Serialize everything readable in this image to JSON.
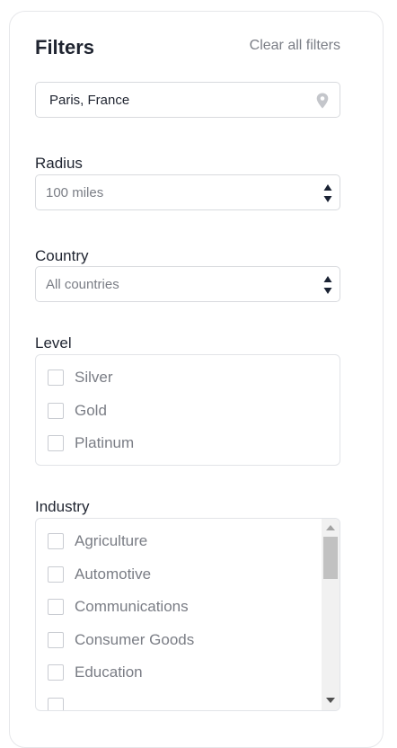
{
  "filters": {
    "title": "Filters",
    "clear_all": "Clear all filters"
  },
  "location": {
    "value": "Paris, France",
    "icon": "map-pin-icon"
  },
  "radius": {
    "label": "Radius",
    "selected": "100 miles"
  },
  "country": {
    "label": "Country",
    "selected": "All countries"
  },
  "level": {
    "label": "Level",
    "options": [
      "Silver",
      "Gold",
      "Platinum"
    ]
  },
  "industry": {
    "label": "Industry",
    "options": [
      "Agriculture",
      "Automotive",
      "Communications",
      "Consumer Goods",
      "Education"
    ]
  },
  "colors": {
    "text": "#1f2430",
    "muted": "#7a7d85",
    "border": "#d8dade"
  }
}
